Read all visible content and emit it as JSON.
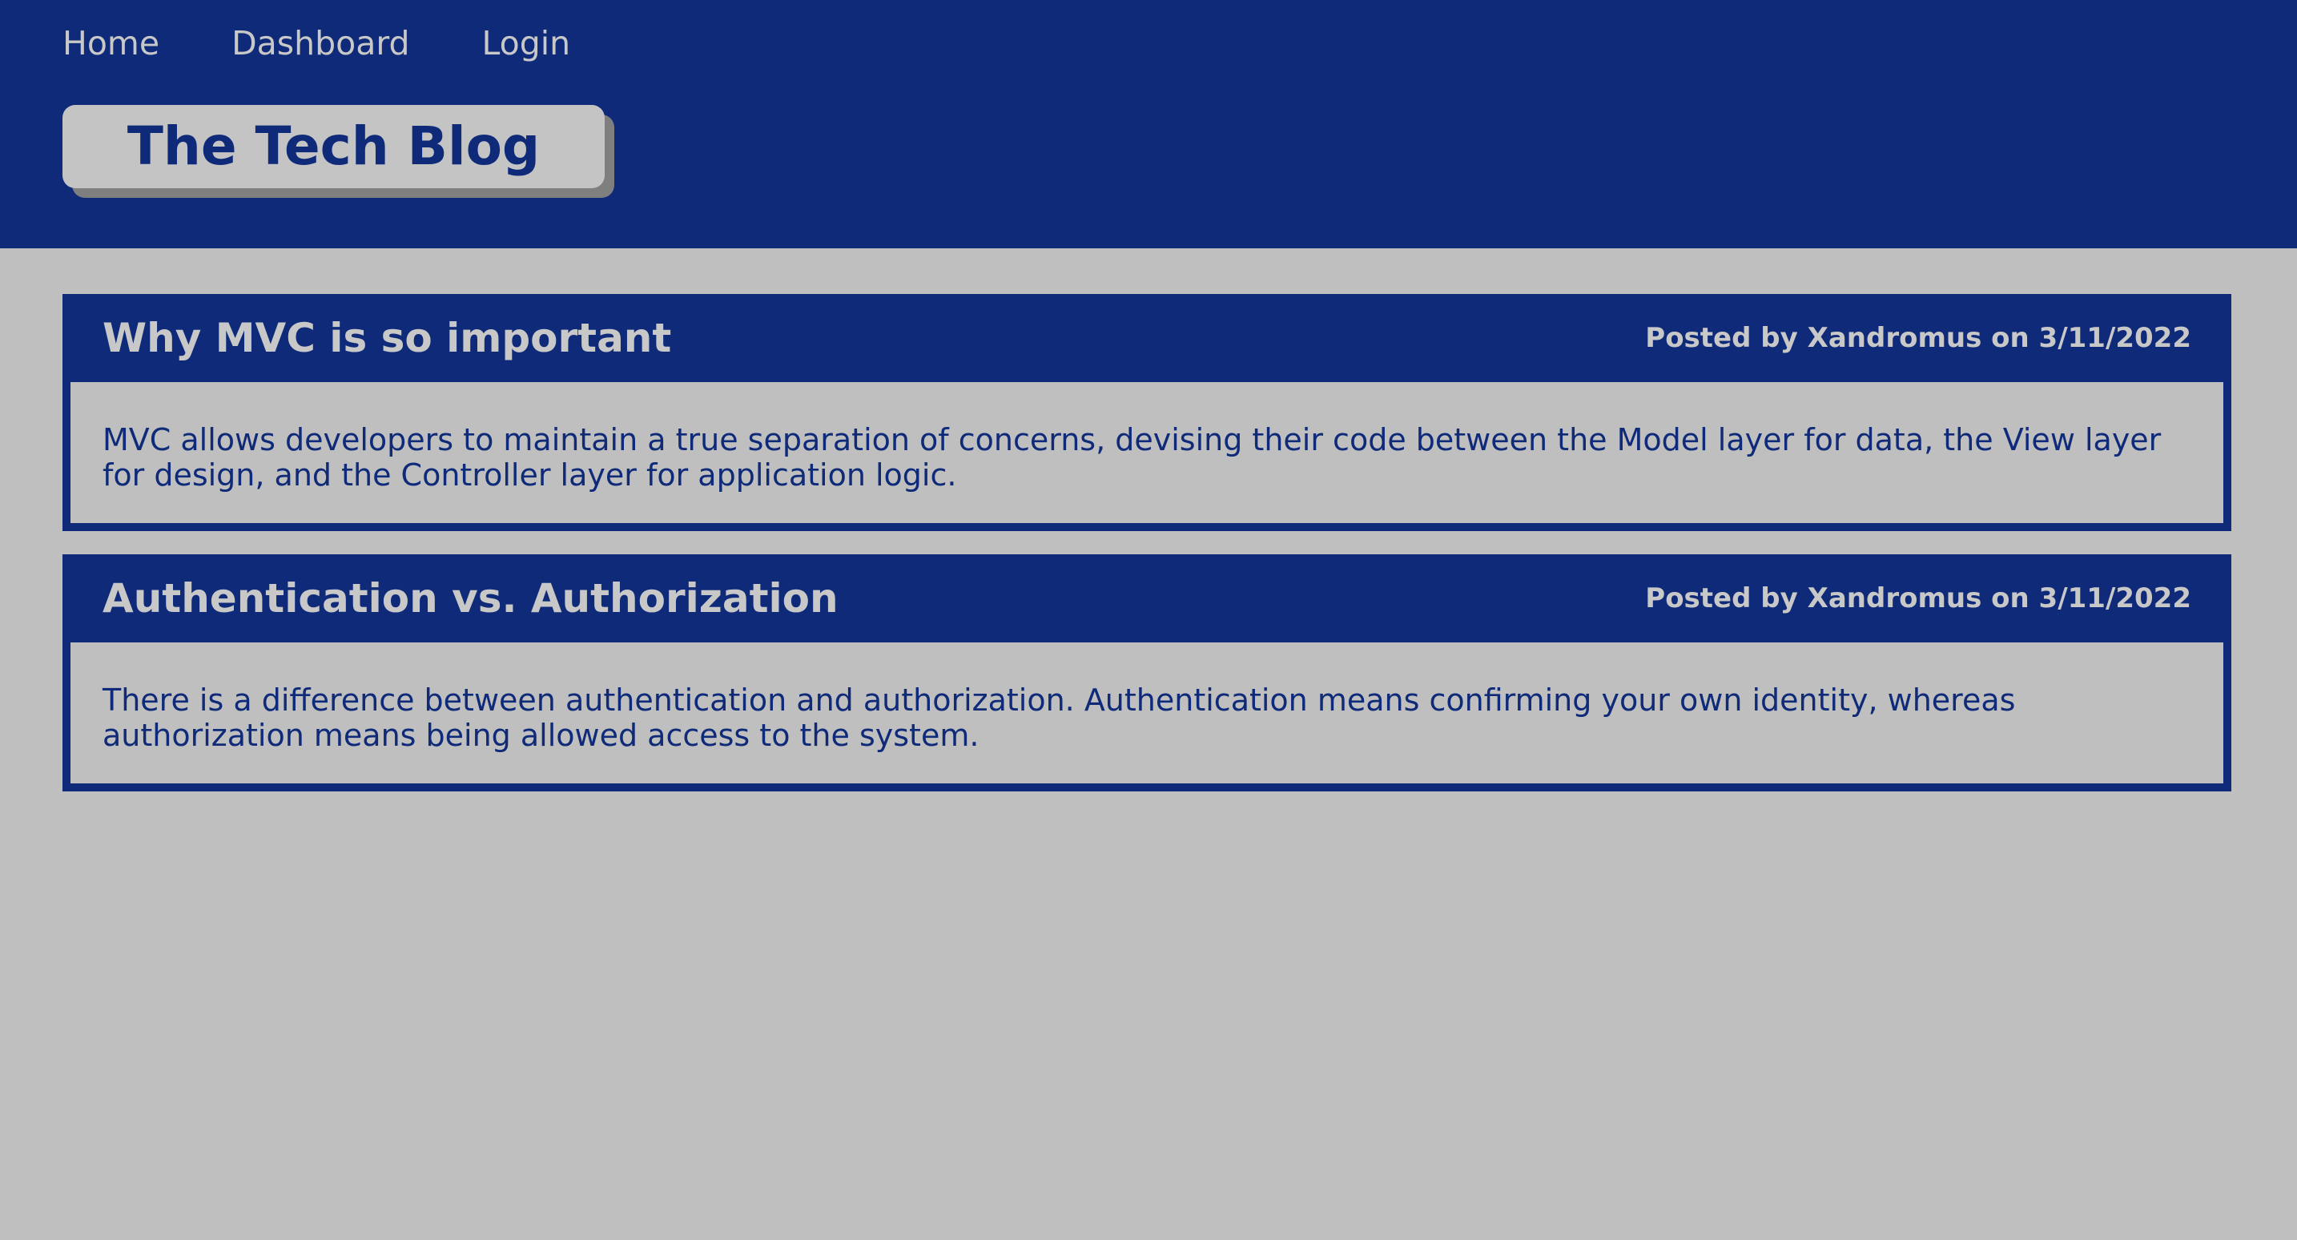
{
  "nav": {
    "items": [
      {
        "label": "Home"
      },
      {
        "label": "Dashboard"
      },
      {
        "label": "Login"
      }
    ]
  },
  "brand": {
    "title": "The Tech Blog"
  },
  "posts": [
    {
      "title": "Why MVC is so important",
      "meta": "Posted by Xandromus on 3/11/2022",
      "body": "MVC allows developers to maintain a true separation of concerns, devising their code between the Model layer for data, the View layer for design, and the Controller layer for application logic."
    },
    {
      "title": "Authentication vs. Authorization",
      "meta": "Posted by Xandromus on 3/11/2022",
      "body": "There is a difference between authentication and authorization. Authentication means confirming your own identity, whereas authorization means being allowed access to the system."
    }
  ],
  "colors": {
    "primary": "#0e2a79",
    "background": "#bfbfbf",
    "text_light": "#c8c8c8"
  }
}
